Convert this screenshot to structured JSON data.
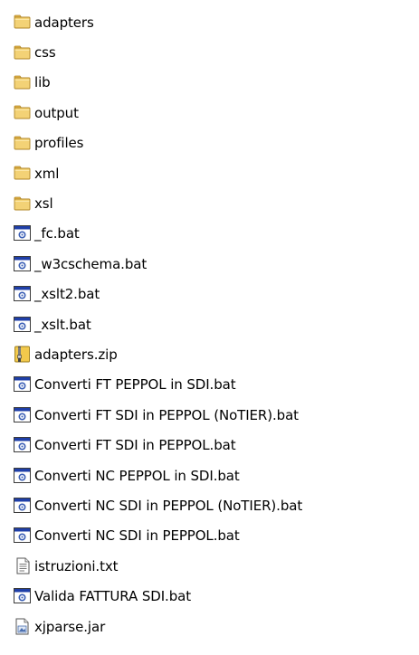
{
  "window": {
    "title": "",
    "view": "list"
  },
  "colors": {
    "folder_body": "#f3d276",
    "folder_tab": "#e8b84a",
    "folder_outline": "#b08525",
    "bat_titlebar": "#1f3fa8",
    "bat_gear": "#3b5fb5",
    "zip_body": "#f2c94c",
    "zip_strip": "#444444"
  },
  "items": [
    {
      "name": "adapters",
      "icon": "folder-icon",
      "kind": "folder"
    },
    {
      "name": "css",
      "icon": "folder-icon",
      "kind": "folder"
    },
    {
      "name": "lib",
      "icon": "folder-icon",
      "kind": "folder"
    },
    {
      "name": "output",
      "icon": "folder-icon",
      "kind": "folder"
    },
    {
      "name": "profiles",
      "icon": "folder-icon",
      "kind": "folder"
    },
    {
      "name": "xml",
      "icon": "folder-icon",
      "kind": "folder"
    },
    {
      "name": "xsl",
      "icon": "folder-icon",
      "kind": "folder"
    },
    {
      "name": "_fc.bat",
      "icon": "batch-file-icon",
      "kind": "bat"
    },
    {
      "name": "_w3cschema.bat",
      "icon": "batch-file-icon",
      "kind": "bat"
    },
    {
      "name": "_xslt2.bat",
      "icon": "batch-file-icon",
      "kind": "bat"
    },
    {
      "name": "_xslt.bat",
      "icon": "batch-file-icon",
      "kind": "bat"
    },
    {
      "name": "adapters.zip",
      "icon": "zip-archive-icon",
      "kind": "zip"
    },
    {
      "name": "Converti FT PEPPOL in SDI.bat",
      "icon": "batch-file-icon",
      "kind": "bat"
    },
    {
      "name": "Converti FT SDI in PEPPOL (NoTIER).bat",
      "icon": "batch-file-icon",
      "kind": "bat"
    },
    {
      "name": "Converti FT SDI in PEPPOL.bat",
      "icon": "batch-file-icon",
      "kind": "bat"
    },
    {
      "name": "Converti NC PEPPOL in SDI.bat",
      "icon": "batch-file-icon",
      "kind": "bat"
    },
    {
      "name": "Converti NC SDI in PEPPOL (NoTIER).bat",
      "icon": "batch-file-icon",
      "kind": "bat"
    },
    {
      "name": "Converti NC SDI in PEPPOL.bat",
      "icon": "batch-file-icon",
      "kind": "bat"
    },
    {
      "name": "istruzioni.txt",
      "icon": "text-file-icon",
      "kind": "txt"
    },
    {
      "name": "Valida FATTURA SDI.bat",
      "icon": "batch-file-icon",
      "kind": "bat"
    },
    {
      "name": "xjparse.jar",
      "icon": "jar-file-icon",
      "kind": "jar"
    }
  ]
}
